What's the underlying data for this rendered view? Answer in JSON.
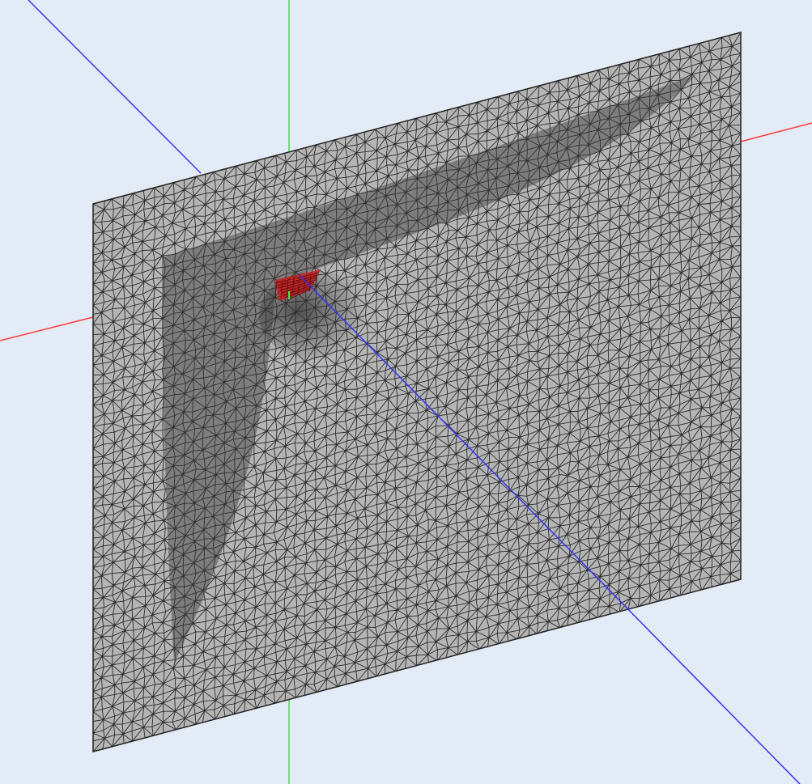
{
  "viewport": {
    "background_color": "#e3ebf6",
    "x_axis_color": "#ff3b3b",
    "y_axis_color": "#3ee33e",
    "z_axis_color": "#3434f0",
    "mesh_fill_color": "#555555",
    "mesh_edge_color": "#222222",
    "mesh_line_color": "#b5b5b5",
    "highlight_color": "#c21a1a"
  }
}
